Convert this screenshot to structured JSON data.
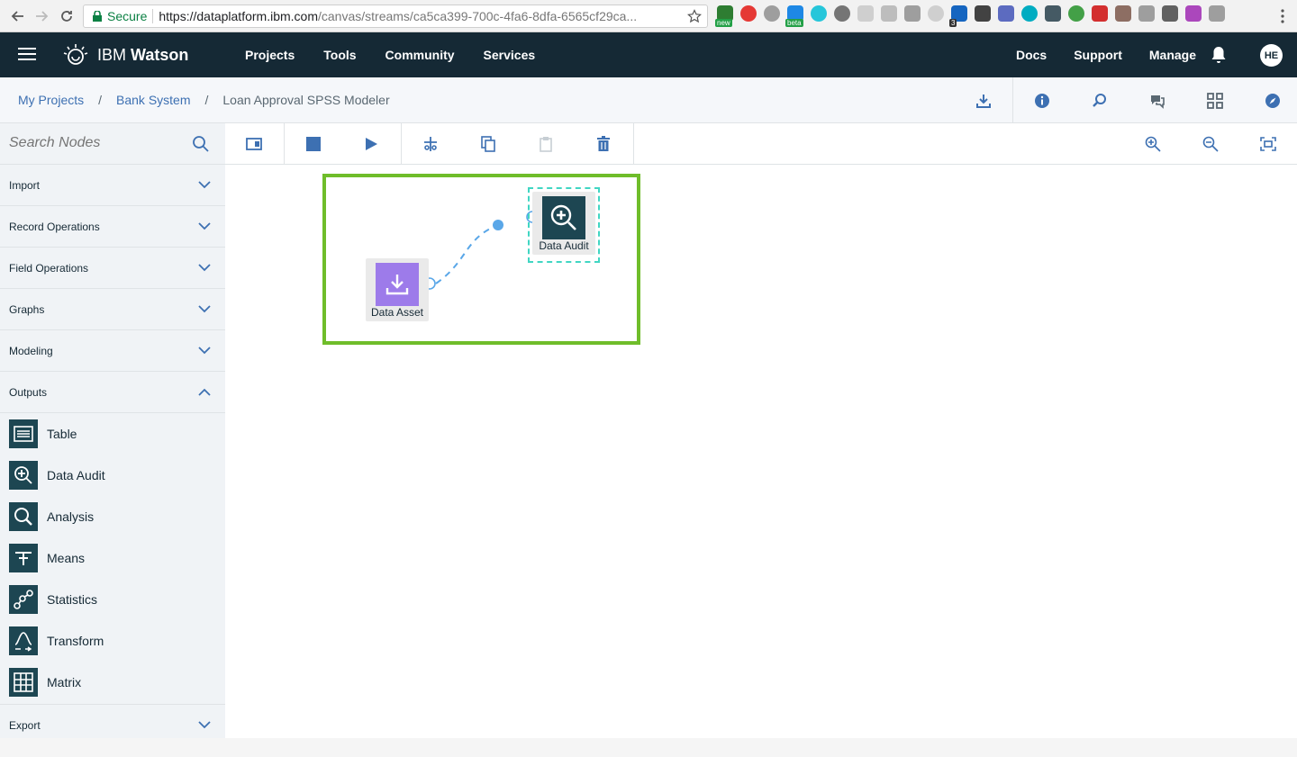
{
  "browser": {
    "secure_label": "Secure",
    "url_host": "https://dataplatform.ibm.com",
    "url_path": "/canvas/streams/ca5ca399-700c-4fa6-8dfa-6565cf29ca...",
    "ext_badges": [
      "new",
      "beta",
      "3"
    ]
  },
  "topnav": {
    "brand_ibm": "IBM",
    "brand_product": "Watson",
    "menu": [
      "Projects",
      "Tools",
      "Community",
      "Services"
    ],
    "right_menu": [
      "Docs",
      "Support",
      "Manage"
    ],
    "avatar_initials": "HE"
  },
  "breadcrumb": {
    "items": [
      "My Projects",
      "Bank System",
      "Loan Approval SPSS Modeler"
    ],
    "separator": "/"
  },
  "sidebar": {
    "search_placeholder": "Search Nodes",
    "categories_top": [
      "Import",
      "Record Operations",
      "Field Operations",
      "Graphs",
      "Modeling"
    ],
    "expanded_category": "Outputs",
    "output_nodes": [
      "Table",
      "Data Audit",
      "Analysis",
      "Means",
      "Statistics",
      "Transform",
      "Matrix"
    ],
    "categories_bottom": [
      "Export"
    ]
  },
  "canvas": {
    "nodes": [
      {
        "label": "Data Asset",
        "icon": "download-icon",
        "color": "#9d7bea"
      },
      {
        "label": "Data Audit",
        "icon": "zoom-in-icon",
        "color": "#1d4652"
      }
    ]
  },
  "colors": {
    "topnav_bg": "#152935",
    "link": "#3d70b2",
    "highlight_box": "#6fbd2a",
    "selection": "#41d6c3",
    "link_line": "#5aa7e8"
  }
}
